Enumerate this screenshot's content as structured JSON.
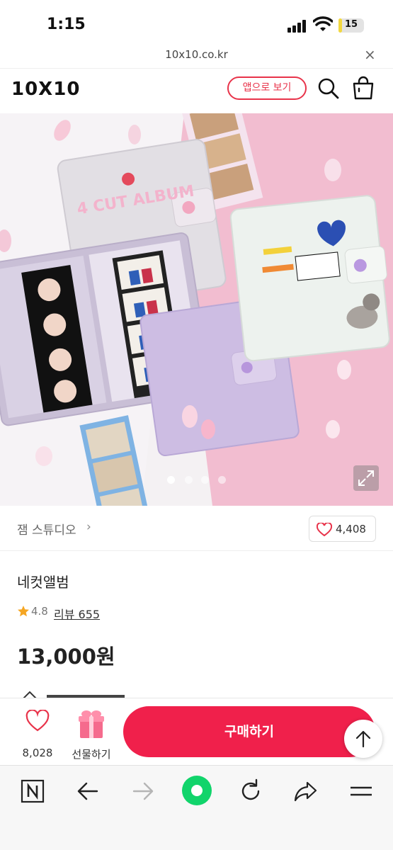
{
  "status_bar": {
    "time": "1:15",
    "battery": "15",
    "battery_level": 0.15
  },
  "browser": {
    "url": "10x10.co.kr",
    "close_glyph": "×"
  },
  "header": {
    "logo": "10X10",
    "app_button": "앱으로 보기",
    "icons": [
      "search-icon",
      "shopping-bag-icon"
    ]
  },
  "hero": {
    "album_title": "4 CUT ALBUM",
    "slide_count": 4,
    "active_slide": 1,
    "icons": [
      "expand-icon"
    ]
  },
  "brand": {
    "name": "잼 스튜디오",
    "chevron": "›",
    "like_count": "4,408"
  },
  "product": {
    "name": "네컷앨범",
    "rating": "4.8",
    "review_label": "리뷰 655",
    "price": "13,000원"
  },
  "bottom": {
    "wish_count": "8,028",
    "gift_label": "선물하기",
    "buy_label": "구매하기"
  },
  "browser_toolbar": {
    "icons": [
      "naver-n-icon",
      "back-arrow-icon",
      "forward-arrow-icon",
      "green-circle-icon",
      "refresh-icon",
      "share-icon",
      "menu-icon"
    ]
  },
  "colors": {
    "accent": "#f0204b",
    "outline_accent": "#e8334a",
    "pink_bg": "#f2bdd0",
    "star": "#f5a623"
  }
}
